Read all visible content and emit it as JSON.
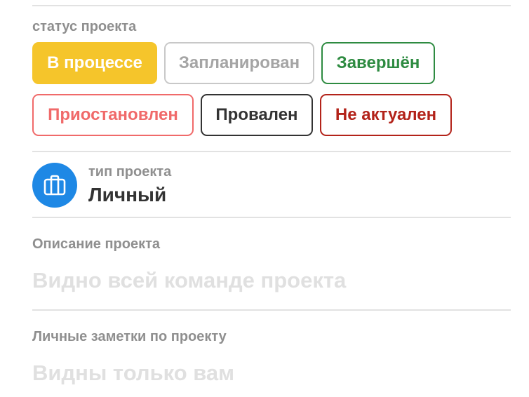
{
  "status": {
    "label": "статус проекта",
    "chips": [
      {
        "label": "В процессе",
        "color": "#f5c52b",
        "selected": true
      },
      {
        "label": "Запланирован",
        "color": "#a5a5a5",
        "selected": false
      },
      {
        "label": "Завершён",
        "color": "#2e8b41",
        "selected": false
      },
      {
        "label": "Приостановлен",
        "color": "#f06a6a",
        "selected": false
      },
      {
        "label": "Провален",
        "color": "#333333",
        "selected": false
      },
      {
        "label": "Не актуален",
        "color": "#b3231a",
        "selected": false
      }
    ]
  },
  "project_type": {
    "label": "тип проекта",
    "value": "Личный",
    "icon": "briefcase-icon",
    "icon_color": "#1e88e5"
  },
  "description": {
    "label": "Описание проекта",
    "placeholder": "Видно всей команде проекта"
  },
  "notes": {
    "label": "Личные заметки по проекту",
    "placeholder": "Видны только вам"
  }
}
